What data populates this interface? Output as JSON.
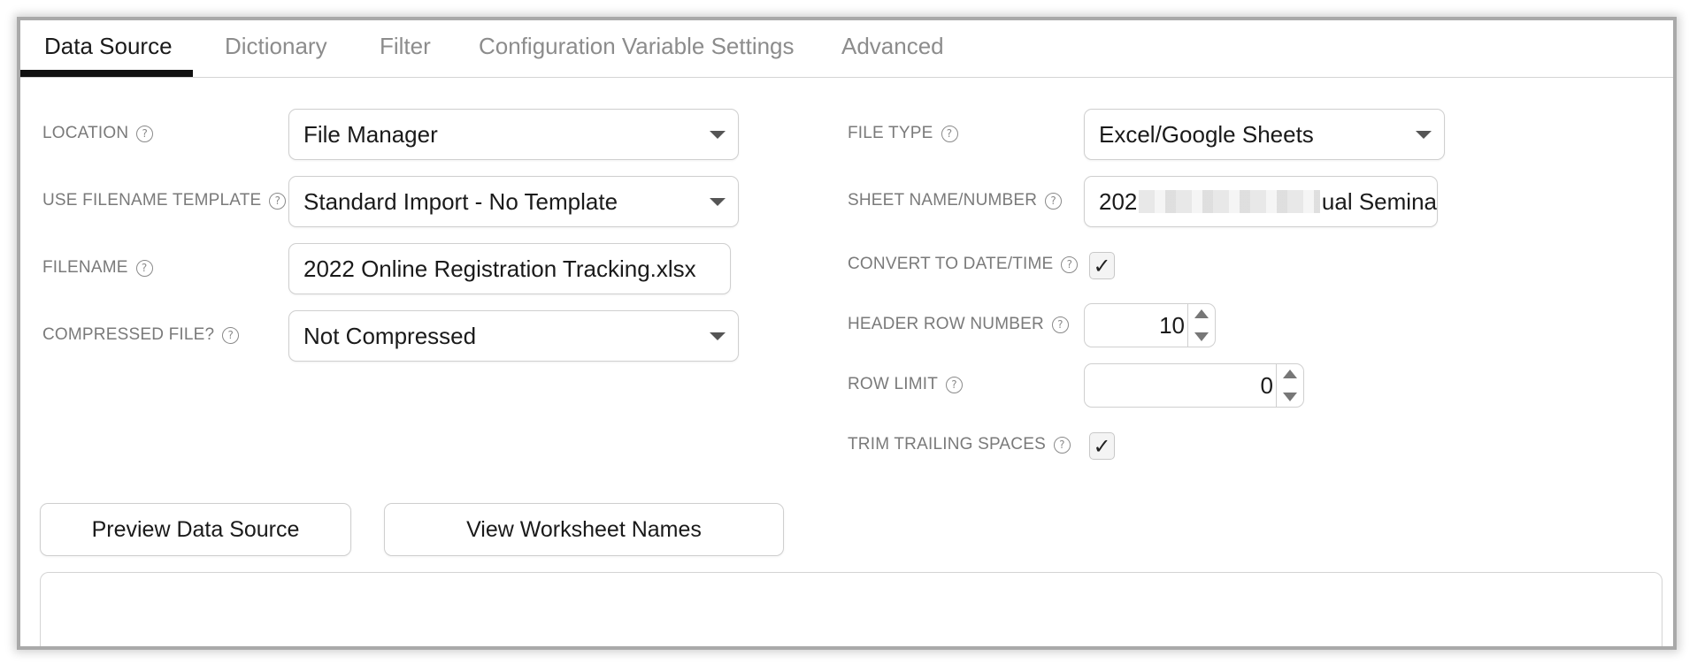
{
  "tabs": [
    {
      "label": "Data Source",
      "active": true
    },
    {
      "label": "Dictionary",
      "active": false
    },
    {
      "label": "Filter",
      "active": false
    },
    {
      "label": "Configuration Variable Settings",
      "active": false
    },
    {
      "label": "Advanced",
      "active": false
    }
  ],
  "left": {
    "location": {
      "label": "LOCATION",
      "value": "File Manager"
    },
    "filename_template": {
      "label": "USE FILENAME TEMPLATE",
      "value": "Standard Import - No Template"
    },
    "filename": {
      "label": "FILENAME",
      "value": "2022 Online Registration Tracking.xlsx"
    },
    "compressed": {
      "label": "COMPRESSED FILE?",
      "value": "Not Compressed"
    }
  },
  "right": {
    "file_type": {
      "label": "FILE TYPE",
      "value": "Excel/Google Sheets"
    },
    "sheet_name": {
      "label": "SHEET NAME/NUMBER",
      "value_start": "202",
      "value_end": "ual Semina"
    },
    "convert_datetime": {
      "label": "CONVERT TO DATE/TIME",
      "checked": true
    },
    "header_row": {
      "label": "HEADER ROW NUMBER",
      "value": "10"
    },
    "row_limit": {
      "label": "ROW LIMIT",
      "value": "0"
    },
    "trim_spaces": {
      "label": "TRIM TRAILING SPACES",
      "checked": true
    }
  },
  "buttons": {
    "preview": "Preview Data Source",
    "worksheets": "View Worksheet Names"
  },
  "glyphs": {
    "help": "?",
    "check": "✓"
  }
}
